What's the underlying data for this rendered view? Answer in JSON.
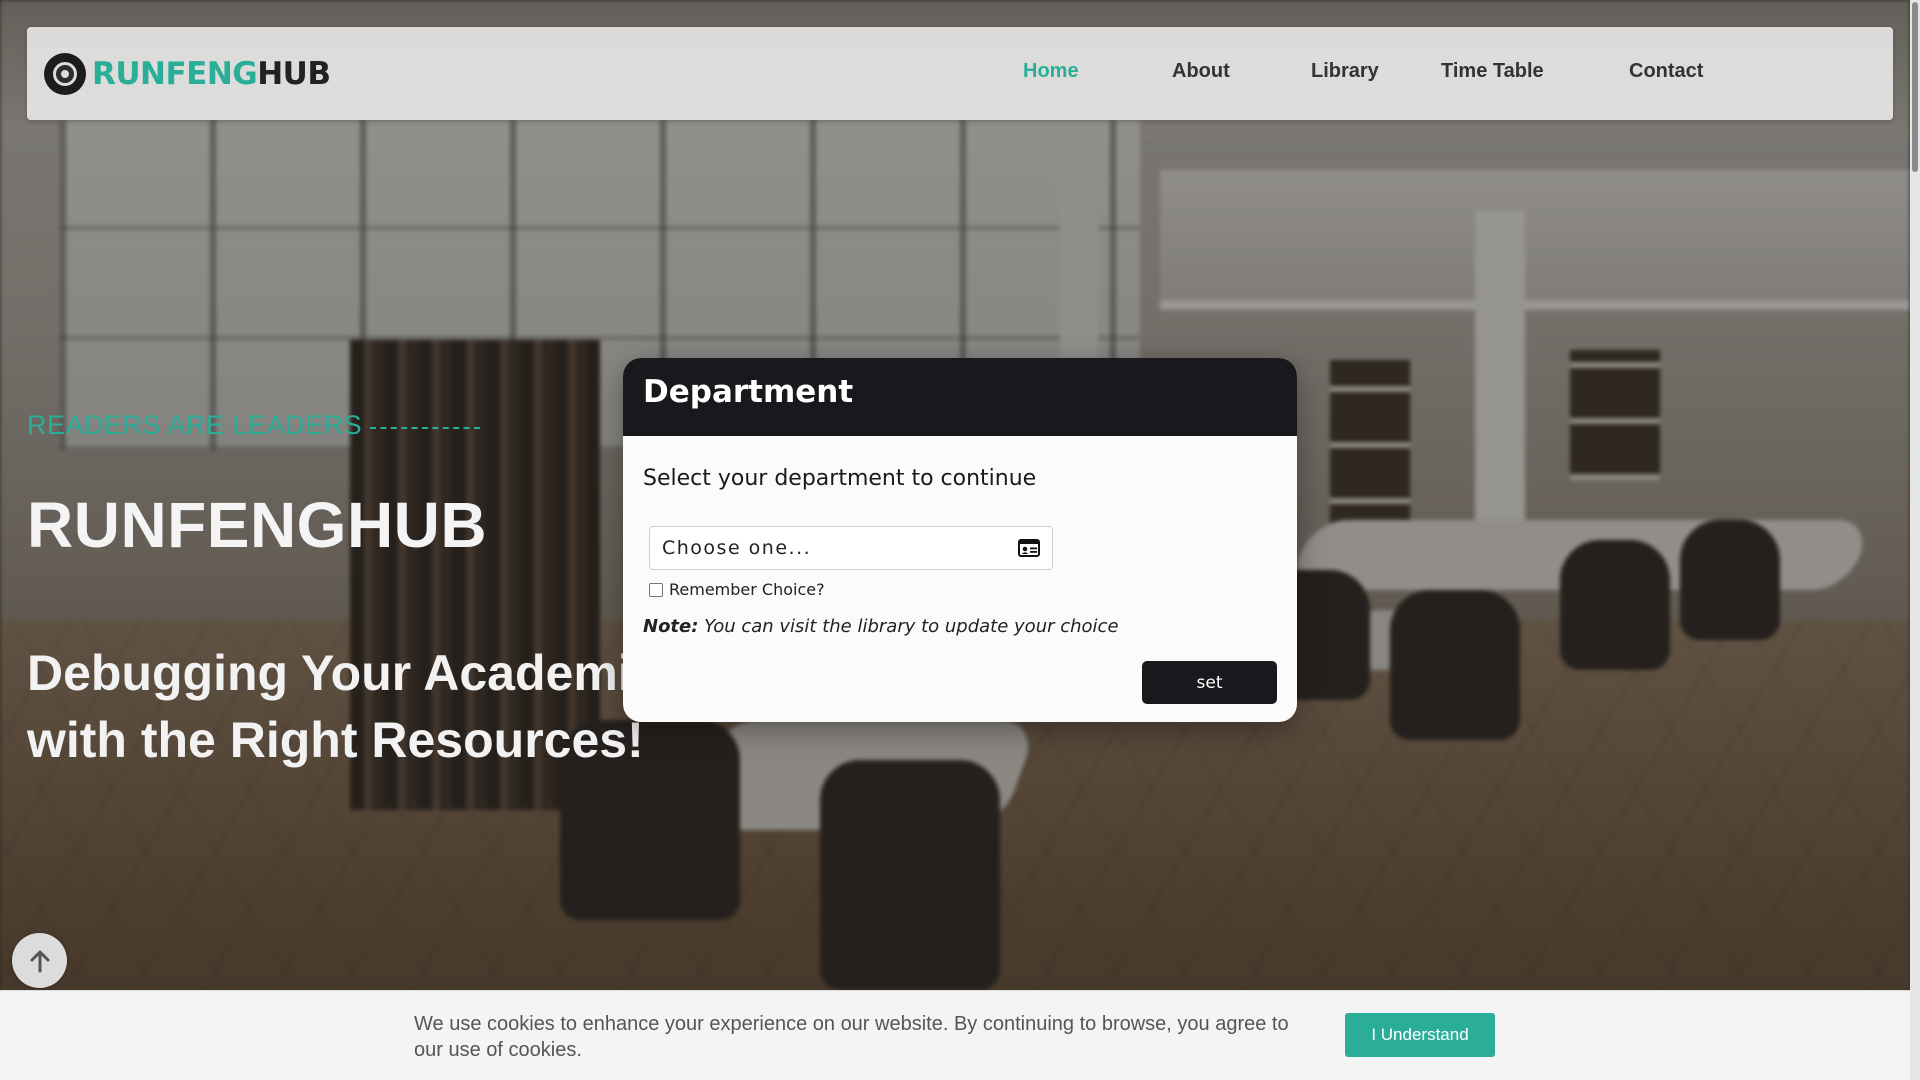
{
  "brand": {
    "name_part1": "RUNFENG",
    "name_part2": "HUB"
  },
  "nav": {
    "items": [
      {
        "label": "Home",
        "active": true
      },
      {
        "label": "About",
        "active": false
      },
      {
        "label": "Library",
        "active": false
      },
      {
        "label": "Time Table",
        "active": false
      },
      {
        "label": "Contact",
        "active": false
      }
    ]
  },
  "hero": {
    "tagline": "READERS ARE LEADERS",
    "title": "RUNFENGHUB",
    "subtitle": "Debugging Your Academi with the Right Resources!"
  },
  "modal": {
    "title": "Department",
    "prompt": "Select your department to continue",
    "select": {
      "value": "Choose one...",
      "icon": "id-card-icon"
    },
    "remember_label": "Remember Choice?",
    "remember_checked": false,
    "note_label": "Note:",
    "note_text": " You can visit the library to update your choice",
    "submit_label": "set"
  },
  "cookie": {
    "text": "We use cookies to enhance your experience on our website. By continuing to browse, you agree to our use of cookies.",
    "button_label": "I Understand"
  },
  "colors": {
    "accent": "#2aae98",
    "dark": "#19191d"
  }
}
